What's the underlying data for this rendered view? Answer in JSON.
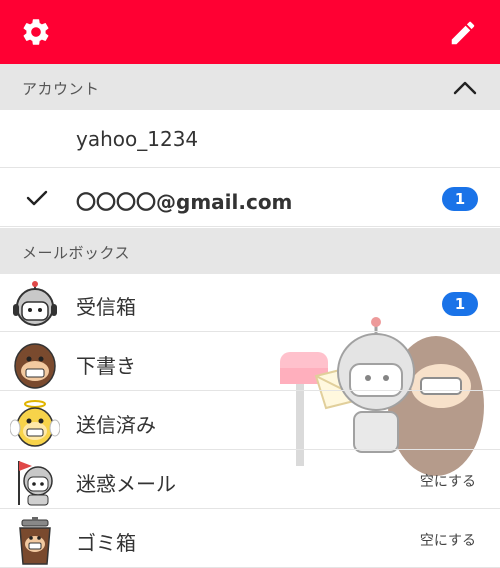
{
  "topbar": {
    "left_icon": "gear-icon",
    "right_icon": "pencil-icon",
    "color": "#ff0033"
  },
  "accounts_section": {
    "label": "アカウント",
    "toggle_icon": "chevron-up-icon"
  },
  "accounts": [
    {
      "name": "yahoo_1234",
      "selected": false
    },
    {
      "name": "〇〇〇〇@gmail.com",
      "selected": true,
      "badge": "1"
    }
  ],
  "mailbox_section": {
    "label": "メールボックス"
  },
  "mailboxes": [
    {
      "label": "受信箱",
      "icon": "robot-mascot-icon",
      "badge": "1"
    },
    {
      "label": "下書き",
      "icon": "monkey-mascot-icon"
    },
    {
      "label": "送信済み",
      "icon": "angel-monkey-icon"
    },
    {
      "label": "迷惑メール",
      "icon": "robot-with-flag-icon",
      "action": "空にする"
    },
    {
      "label": "ゴミ箱",
      "icon": "trash-monkey-icon",
      "action": "空にする"
    }
  ],
  "accent_colors": {
    "badge": "#1a73e8",
    "header_bg": "#e6e6e6"
  }
}
